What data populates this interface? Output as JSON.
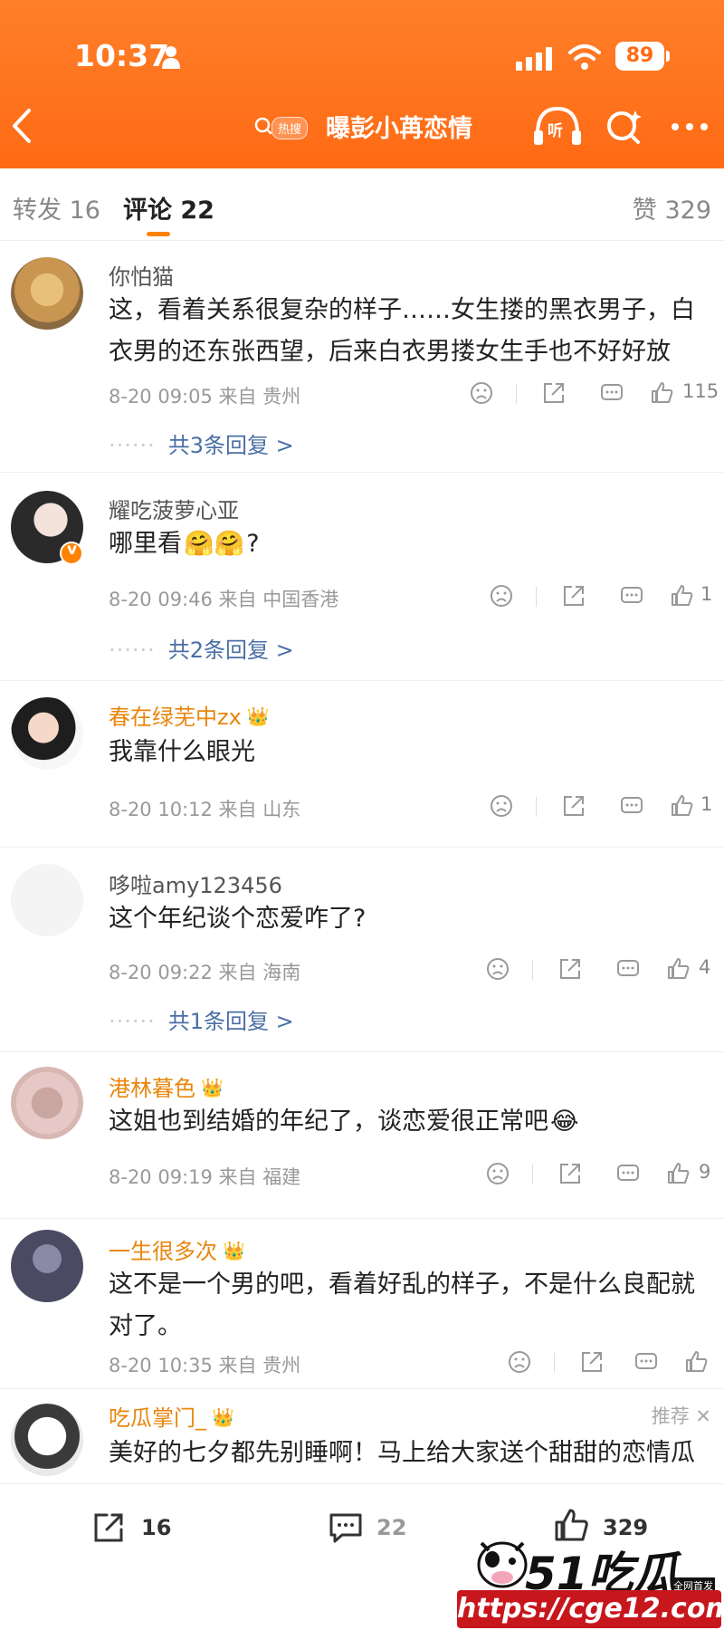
{
  "status_bar": {
    "time": "10:37",
    "battery": "89"
  },
  "nav": {
    "tag": "热搜",
    "title": "曝彭小苒恋情",
    "listen_label": "听"
  },
  "tabs": {
    "repost": "转发 16",
    "comment": "评论 22",
    "like": "赞 329"
  },
  "comments": [
    {
      "user": "你怕猫",
      "text": "这，看着关系很复杂的样子……女生搂的黑衣男子，白衣男的还东张西望，后来白衣男搂女生手也不好好放",
      "meta": "8-20 09:05 来自 贵州",
      "likes": "115",
      "replies": "共3条回复 >"
    },
    {
      "user": "耀吃菠萝心亚",
      "text": "哪里看",
      "emoji": "🤗🤗",
      "text_tail": "?",
      "meta": "8-20 09:46 来自 中国香港",
      "likes": "1",
      "replies": "共2条回复 >"
    },
    {
      "user": "春在绿芜中zx",
      "text": "我靠什么眼光",
      "meta": "8-20 10:12 来自 山东",
      "likes": "1"
    },
    {
      "user": "哆啦amy123456",
      "text": "这个年纪谈个恋爱咋了?",
      "meta": "8-20 09:22 来自 海南",
      "likes": "4",
      "replies": "共1条回复 >"
    },
    {
      "user": "港林暮色",
      "text": "这姐也到结婚的年纪了，谈恋爱很正常吧",
      "emoji": "😂",
      "meta": "8-20 09:19 来自 福建",
      "likes": "9"
    },
    {
      "user": "一生很多次",
      "text": "这不是一个男的吧，看着好乱的样子，不是什么良配就对了。",
      "meta": "8-20 10:35 来自 贵州",
      "likes": ""
    },
    {
      "user": "吃瓜掌门_",
      "text": "美好的七夕都先别睡啊！马上给大家送个甜甜的恋情瓜",
      "recommend": "推荐 ✕"
    }
  ],
  "bottom_bar": {
    "repost_count": "16",
    "comment_count": "22",
    "like_count": "329"
  },
  "watermark": {
    "brand": "51吃瓜",
    "url": "https://cge12.com",
    "tag": "全网首发"
  },
  "colors": {
    "header": "#ff6a14",
    "accent": "#ff8200",
    "link": "#4a6fa5",
    "vip_name": "#e8860c"
  }
}
